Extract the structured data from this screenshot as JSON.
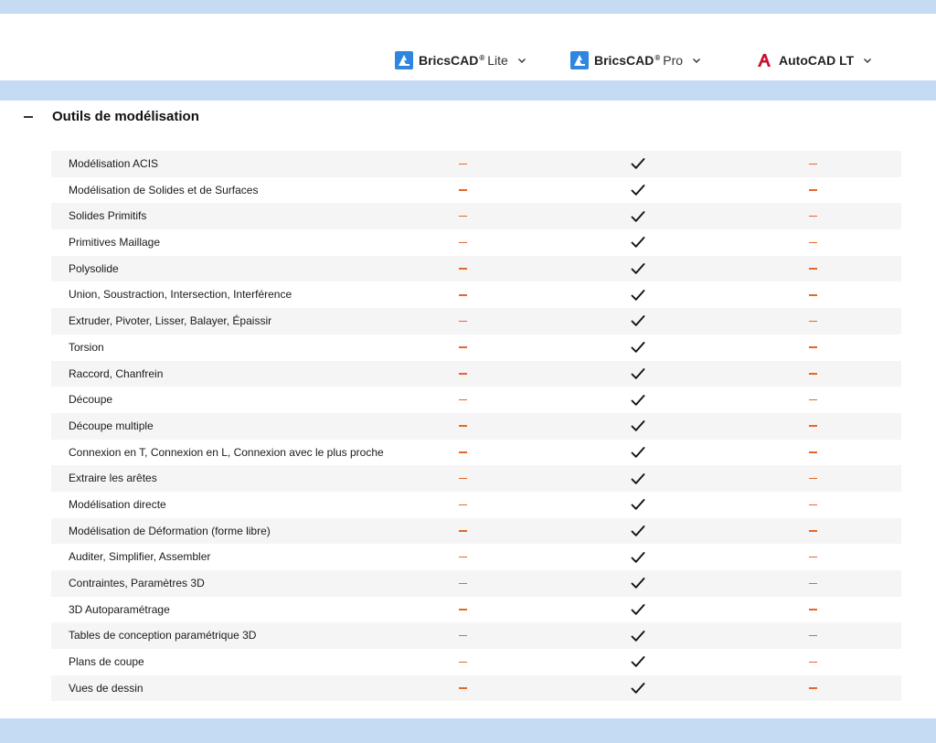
{
  "colors": {
    "band": "#c5dbf4",
    "row_alt": "#f5f5f5",
    "dash": "#e8662a",
    "bricscad_logo": "#2e86de",
    "autocad_logo": "#c8102e"
  },
  "products": [
    {
      "name": "BricsCAD",
      "sup": "®",
      "edition": "Lite",
      "icon": "bricscad-logo-icon"
    },
    {
      "name": "BricsCAD",
      "sup": "®",
      "edition": "Pro",
      "icon": "bricscad-logo-icon"
    },
    {
      "name": "AutoCAD LT",
      "sup": "",
      "edition": "",
      "icon": "autocad-logo-icon"
    }
  ],
  "section": {
    "title": "Outils de modélisation"
  },
  "features": [
    {
      "label": "Modélisation ACIS",
      "values": [
        "no",
        "yes",
        "no"
      ]
    },
    {
      "label": "Modélisation de Solides et de Surfaces",
      "values": [
        "no",
        "yes",
        "no"
      ]
    },
    {
      "label": "Solides Primitifs",
      "values": [
        "no",
        "yes",
        "no"
      ]
    },
    {
      "label": "Primitives Maillage",
      "values": [
        "no",
        "yes",
        "no"
      ]
    },
    {
      "label": "Polysolide",
      "values": [
        "no",
        "yes",
        "no"
      ]
    },
    {
      "label": "Union, Soustraction, Intersection, Interférence",
      "values": [
        "no",
        "yes",
        "no"
      ]
    },
    {
      "label": "Extruder, Pivoter, Lisser, Balayer, Épaissir",
      "values": [
        "no",
        "yes",
        "no"
      ]
    },
    {
      "label": "Torsion",
      "values": [
        "no",
        "yes",
        "no"
      ]
    },
    {
      "label": "Raccord, Chanfrein",
      "values": [
        "no",
        "yes",
        "no"
      ]
    },
    {
      "label": "Découpe",
      "values": [
        "no",
        "yes",
        "no"
      ]
    },
    {
      "label": "Découpe multiple",
      "values": [
        "no",
        "yes",
        "no"
      ]
    },
    {
      "label": "Connexion en T, Connexion en L, Connexion avec le plus proche",
      "values": [
        "no",
        "yes",
        "no"
      ]
    },
    {
      "label": "Extraire les arêtes",
      "values": [
        "no",
        "yes",
        "no"
      ]
    },
    {
      "label": "Modélisation directe",
      "values": [
        "no",
        "yes",
        "no"
      ]
    },
    {
      "label": "Modélisation de Déformation (forme libre)",
      "values": [
        "no",
        "yes",
        "no"
      ]
    },
    {
      "label": "Auditer, Simplifier, Assembler",
      "values": [
        "no",
        "yes",
        "no"
      ]
    },
    {
      "label": "Contraintes, Paramètres 3D",
      "values": [
        "no",
        "yes",
        "no"
      ]
    },
    {
      "label": "3D Autoparamétrage",
      "values": [
        "no",
        "yes",
        "no"
      ]
    },
    {
      "label": "Tables de conception paramétrique 3D",
      "values": [
        "no",
        "yes",
        "no"
      ]
    },
    {
      "label": "Plans de coupe",
      "values": [
        "no",
        "yes",
        "no"
      ]
    },
    {
      "label": "Vues de dessin",
      "values": [
        "no",
        "yes",
        "no"
      ]
    }
  ]
}
